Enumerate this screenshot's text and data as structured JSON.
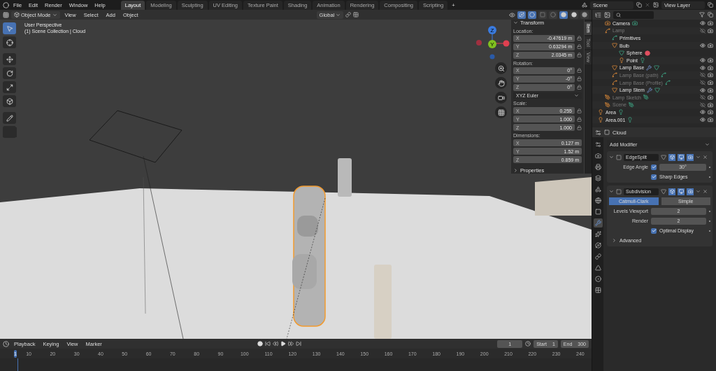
{
  "menu": [
    "File",
    "Edit",
    "Render",
    "Window",
    "Help"
  ],
  "workspaces": [
    {
      "label": "Layout",
      "selected": true
    },
    {
      "label": "Modeling",
      "selected": false
    },
    {
      "label": "Sculpting",
      "selected": false
    },
    {
      "label": "UV Editing",
      "selected": false
    },
    {
      "label": "Texture Paint",
      "selected": false
    },
    {
      "label": "Shading",
      "selected": false
    },
    {
      "label": "Animation",
      "selected": false
    },
    {
      "label": "Rendering",
      "selected": false
    },
    {
      "label": "Compositing",
      "selected": false
    },
    {
      "label": "Scripting",
      "selected": false
    }
  ],
  "add_workspace": "+",
  "scene": "Scene",
  "view_layer": "View Layer",
  "viewport": {
    "mode": "Object Mode",
    "menus": [
      "View",
      "Select",
      "Add",
      "Object"
    ],
    "orientation": "Global",
    "info": [
      "User Perspective",
      "(1) Scene Collection | Cloud"
    ],
    "toggles": [
      {
        "kind": "gizmo",
        "on": true
      },
      {
        "kind": "overlay",
        "on": true
      },
      {
        "kind": "xray",
        "on": false
      }
    ],
    "tools": [
      {
        "kind": "select",
        "selected": true
      },
      {
        "kind": "cursor",
        "selected": false
      },
      {
        "kind": "move",
        "selected": false
      },
      {
        "kind": "rotate",
        "selected": false
      },
      {
        "kind": "scale",
        "selected": false
      },
      {
        "kind": "transform",
        "selected": false
      },
      {
        "kind": "annotate",
        "selected": false
      },
      {
        "kind": "measure",
        "selected": false
      }
    ],
    "shading": [
      {
        "kind": "wireframe",
        "selected": false
      },
      {
        "kind": "solid",
        "selected": true
      },
      {
        "kind": "material",
        "selected": false
      },
      {
        "kind": "rendered",
        "selected": false
      }
    ]
  },
  "gizmo": {
    "axes": [
      "Z",
      "Y"
    ]
  },
  "sidebar": {
    "tabs": [
      {
        "label": "Item",
        "selected": true
      },
      {
        "label": "Tool",
        "selected": false
      },
      {
        "label": "View",
        "selected": false
      }
    ],
    "title": "Transform",
    "groups": [
      {
        "kind": "vector",
        "label": "Location:",
        "lockable": true,
        "fields": [
          {
            "axis": "X",
            "value": "-0.47619 m"
          },
          {
            "axis": "Y",
            "value": "0.63294 m"
          },
          {
            "axis": "Z",
            "value": "2.0345 m"
          }
        ]
      },
      {
        "kind": "vector",
        "label": "Rotation:",
        "lockable": true,
        "fields": [
          {
            "axis": "X",
            "value": "0°"
          },
          {
            "axis": "Y",
            "value": "-0°"
          },
          {
            "axis": "Z",
            "value": "0°"
          }
        ]
      },
      {
        "kind": "dropdown",
        "value": "XYZ Euler"
      },
      {
        "kind": "vector",
        "label": "Scale:",
        "lockable": true,
        "fields": [
          {
            "axis": "X",
            "value": "0.255"
          },
          {
            "axis": "Y",
            "value": "1.000"
          },
          {
            "axis": "Z",
            "value": "1.000"
          }
        ]
      },
      {
        "kind": "vector",
        "label": "Dimensions:",
        "lockable": false,
        "fields": [
          {
            "axis": "X",
            "value": "0.127 m"
          },
          {
            "axis": "Y",
            "value": "1.52 m"
          },
          {
            "axis": "Z",
            "value": "0.859 m"
          }
        ]
      }
    ],
    "properties": "Properties"
  },
  "outliner": {
    "items": [
      {
        "children": [
          {
            "name": "Camera",
            "kind": "camera",
            "hidden": false,
            "modified": false
          },
          {
            "name": "Lamp",
            "kind": "curve",
            "hidden": true,
            "modified": false,
            "children": [
              {
                "name": "Primitives",
                "kind": "curve-data",
                "hidden": false,
                "modified": false
              },
              {
                "name": "Bulb",
                "kind": "mesh",
                "hidden": false,
                "modified": false,
                "children": [
                  {
                    "name": "Sphere",
                    "kind": "mesh-data",
                    "hidden": false,
                    "modified": false
                  },
                  {
                    "name": "Point",
                    "kind": "light",
                    "hidden": false,
                    "modified": false
                  }
                ]
              },
              {
                "name": "Lamp Base",
                "kind": "mesh",
                "hidden": false,
                "modified": true
              },
              {
                "name": "Lamp Base (path)",
                "kind": "curve",
                "hidden": true,
                "modified": false
              },
              {
                "name": "Lamp Base (Profile)",
                "kind": "curve",
                "hidden": true,
                "modified": false
              },
              {
                "name": "Lamp Stem",
                "kind": "mesh",
                "hidden": false,
                "modified": true
              }
            ]
          },
          {
            "name": "Lamp Sketch",
            "kind": "gpencil",
            "hidden": true,
            "modified": false
          },
          {
            "name": "Scene",
            "kind": "gpencil",
            "hidden": true,
            "modified": false
          }
        ]
      },
      {
        "name": "Area",
        "kind": "light",
        "hidden": false,
        "modified": false
      },
      {
        "name": "Area.001",
        "kind": "light",
        "hidden": false,
        "modified": false
      }
    ]
  },
  "properties": {
    "object": "Cloud",
    "add_modifier": "Add Modifier",
    "tabs": [
      {
        "kind": "tool",
        "selected": false
      },
      {
        "kind": "render",
        "selected": false
      },
      {
        "kind": "output",
        "selected": false
      },
      {
        "kind": "view-layer",
        "selected": false
      },
      {
        "kind": "scene",
        "selected": false
      },
      {
        "kind": "world",
        "selected": false
      },
      {
        "kind": "object",
        "selected": false
      },
      {
        "kind": "modifier",
        "selected": true
      },
      {
        "kind": "particles",
        "selected": false
      },
      {
        "kind": "physics",
        "selected": false
      },
      {
        "kind": "constraints",
        "selected": false
      },
      {
        "kind": "data",
        "selected": false
      },
      {
        "kind": "material",
        "selected": false
      },
      {
        "kind": "texture",
        "selected": false
      }
    ],
    "modifiers": [
      {
        "name": "EdgeSplit",
        "expanded": true,
        "rows": [
          {
            "kind": "check_value",
            "label": "Edge Angle",
            "checked": true,
            "value": "30°"
          },
          {
            "kind": "check",
            "label": "Sharp Edges",
            "checked": true
          }
        ]
      },
      {
        "name": "Subdivision",
        "expanded": true,
        "rows": [
          {
            "kind": "segmented",
            "options": [
              {
                "label": "Catmull-Clark",
                "selected": true
              },
              {
                "label": "Simple",
                "selected": false
              }
            ]
          },
          {
            "kind": "number",
            "label": "Levels Viewport",
            "value": "2"
          },
          {
            "kind": "number",
            "label": "Render",
            "value": "2"
          },
          {
            "kind": "check",
            "label": "Optimal Display",
            "checked": true
          },
          {
            "kind": "subpanel",
            "label": "Advanced",
            "expanded": false
          }
        ]
      }
    ]
  },
  "timeline": {
    "menus": [
      "Playback",
      "Keying",
      "View",
      "Marker"
    ],
    "frame": "1",
    "start_label": "Start",
    "start": "1",
    "end_label": "End",
    "end": "300",
    "current": "1",
    "ticks": [
      "10",
      "20",
      "30",
      "40",
      "50",
      "60",
      "70",
      "80",
      "90",
      "100",
      "110",
      "120",
      "130",
      "140",
      "150",
      "160",
      "170",
      "180",
      "190",
      "200",
      "210",
      "220",
      "230",
      "240"
    ]
  }
}
